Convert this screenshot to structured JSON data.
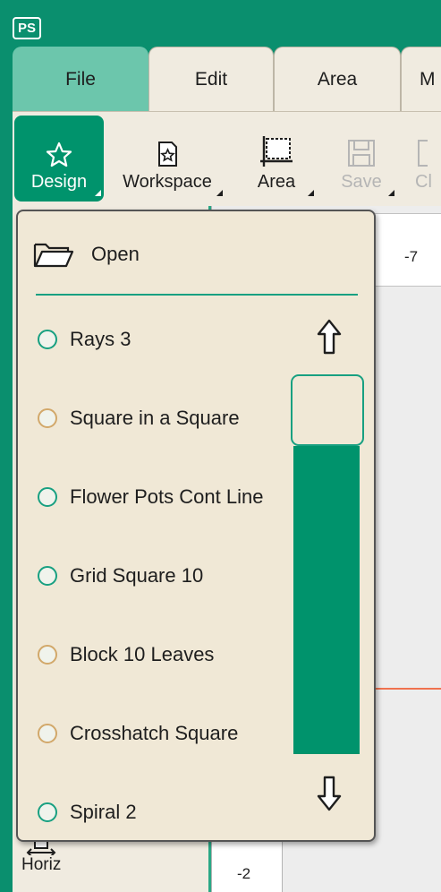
{
  "app": {
    "badge": "PS"
  },
  "tabs": [
    {
      "label": "File",
      "active": true
    },
    {
      "label": "Edit",
      "active": false
    },
    {
      "label": "Area",
      "active": false
    },
    {
      "label": "M",
      "active": false
    }
  ],
  "ribbon": {
    "design": "Design",
    "workspace": "Workspace",
    "area": "Area",
    "save": "Save",
    "clipped": "Cl"
  },
  "canvas": {
    "ruler_top_label": "-7",
    "ruler_bottom_label": "-2",
    "horiz_label": "Horiz"
  },
  "dropdown": {
    "open_label": "Open",
    "items": [
      {
        "label": "Rays 3",
        "dot": "teal"
      },
      {
        "label": "Square in a Square",
        "dot": "tan"
      },
      {
        "label": "Flower Pots Cont Line",
        "dot": "teal"
      },
      {
        "label": "Grid Square 10",
        "dot": "teal"
      },
      {
        "label": "Block 10 Leaves",
        "dot": "tan"
      },
      {
        "label": "Crosshatch Square",
        "dot": "tan"
      },
      {
        "label": "Spiral 2",
        "dot": "teal"
      }
    ]
  },
  "colors": {
    "accent": "#00936c",
    "tab_active": "#6cc6ac",
    "panel": "#f0e8d6",
    "guide": "#f0724f"
  }
}
